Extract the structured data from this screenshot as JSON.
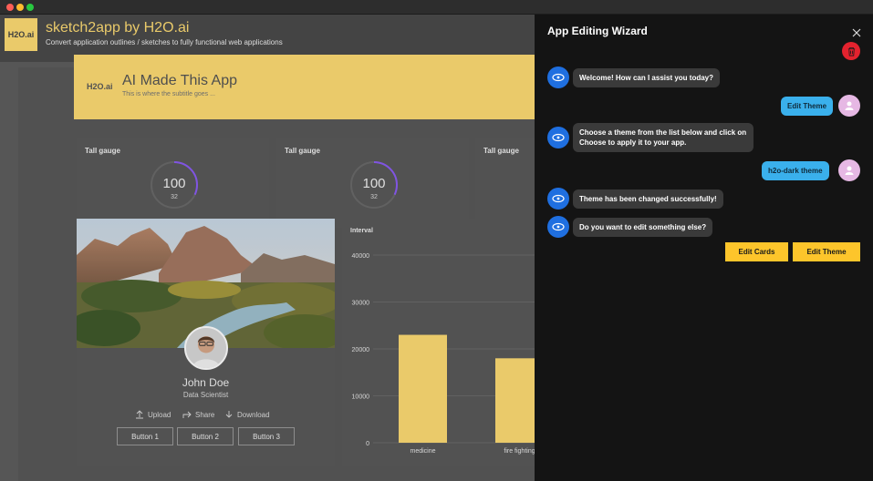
{
  "app": {
    "logo_text": "H2O.ai",
    "title": "sketch2app by H2O.ai",
    "subtitle": "Convert application outlines / sketches to fully functional web applications"
  },
  "hero": {
    "logo_text": "H2O.ai",
    "title": "AI Made This App",
    "subtitle": "This is where the subtitle goes ..."
  },
  "gauges": [
    {
      "title": "Tall gauge",
      "value": "100",
      "aux": "32",
      "fraction": 0.32
    },
    {
      "title": "Tall gauge",
      "value": "100",
      "aux": "32",
      "fraction": 0.32
    },
    {
      "title": "Tall gauge"
    }
  ],
  "profile": {
    "name": "John Doe",
    "role": "Data Scientist",
    "actions": [
      "Upload",
      "Share",
      "Download"
    ],
    "buttons": [
      "Button 1",
      "Button 2",
      "Button 3"
    ]
  },
  "chart_data": {
    "type": "bar",
    "title": "Interval",
    "categories": [
      "medicine",
      "fire fighting"
    ],
    "values": [
      23000,
      18000
    ],
    "ylim": [
      0,
      40000
    ],
    "yticks": [
      "40000",
      "30000",
      "20000",
      "10000",
      "0"
    ],
    "bar_color": "#fedc74",
    "grid": true
  },
  "wizard": {
    "title": "App Editing Wizard",
    "messages": [
      {
        "from": "bot",
        "text": "Welcome! How can I assist you today?"
      },
      {
        "from": "user",
        "text": "Edit Theme"
      },
      {
        "from": "bot",
        "text": "Choose a theme from the list below and click on Choose to apply it to your app."
      },
      {
        "from": "user",
        "text": "h2o-dark theme"
      },
      {
        "from": "bot",
        "text": "Theme has been changed successfully!"
      },
      {
        "from": "bot",
        "text": "Do you want to edit something else?"
      }
    ],
    "choices": [
      "Edit Cards",
      "Edit Theme"
    ]
  },
  "colors": {
    "accent": "#fedc74",
    "button": "#fdc52b",
    "user_bubble": "#3ab0ec",
    "bot_avatar": "#1f6fe0",
    "delete": "#e4222e"
  }
}
